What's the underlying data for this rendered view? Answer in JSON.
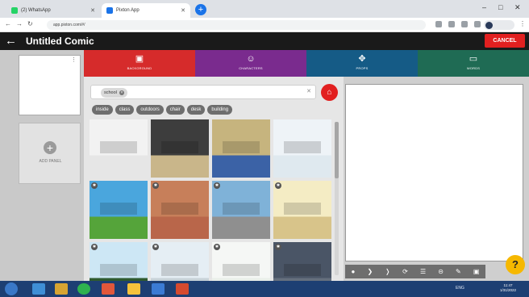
{
  "browser": {
    "tabs": [
      {
        "label": "(2) WhatsApp",
        "active": false
      },
      {
        "label": "Pixton App",
        "active": true
      }
    ],
    "url": "app.pixton.com/#/"
  },
  "app": {
    "title": "Untitled Comic",
    "cancel_label": "CANCEL"
  },
  "panels": {
    "add_label": "ADD PANEL"
  },
  "categories": [
    {
      "label": "BACKGROUND",
      "color": "#d62b2b",
      "icon": "image-icon"
    },
    {
      "label": "CHARACTERS",
      "color": "#7a2b8e",
      "icon": "face-icon"
    },
    {
      "label": "PROPS",
      "color": "#155b86",
      "icon": "move-icon"
    },
    {
      "label": "WORDS",
      "color": "#1f6b54",
      "icon": "speech-bubble-icon"
    }
  ],
  "search": {
    "tag": "school"
  },
  "filter_chips": [
    "inside",
    "class",
    "outdoors",
    "chair",
    "desk",
    "building"
  ],
  "backgrounds": [
    {
      "scene": "igloo-room",
      "sky": "#f2f2f2",
      "ground": "#e6e6e6"
    },
    {
      "scene": "chalkboard-classroom",
      "sky": "#3d3d3d",
      "ground": "#c9b68a"
    },
    {
      "scene": "hallway-lockers",
      "sky": "#c6b47e",
      "ground": "#3b62a6"
    },
    {
      "scene": "classroom-desks",
      "sky": "#eef3f7",
      "ground": "#dfe9ef"
    },
    {
      "scene": "school-field",
      "sky": "#4aa6dd",
      "ground": "#55a43a"
    },
    {
      "scene": "brick-wall",
      "sky": "#c77f5a",
      "ground": "#b9664a"
    },
    {
      "scene": "school-building",
      "sky": "#7fb2d8",
      "ground": "#8f8f8f"
    },
    {
      "scene": "cafeteria",
      "sky": "#f4ecc4",
      "ground": "#d8c48a"
    },
    {
      "scene": "green-classroom",
      "sky": "#cde7f5",
      "ground": "#2f5a2f"
    },
    {
      "scene": "teacher-desk",
      "sky": "#e5eef4",
      "ground": "#c7d2d8"
    },
    {
      "scene": "bright-classroom",
      "sky": "#f5f7f5",
      "ground": "#e9efe9"
    },
    {
      "scene": "night-city",
      "sky": "#4a5566",
      "ground": "#656f7d"
    }
  ],
  "toolbar_icons": [
    "bullet-icon",
    "bracket-left-icon",
    "bracket-right-icon",
    "rotate-icon",
    "stack-icon",
    "lock-icon",
    "pencil-icon",
    "camera-icon"
  ],
  "help_label": "?",
  "taskbar": {
    "time": "11:47",
    "date": "1/31/2022",
    "lang": "ENG"
  }
}
